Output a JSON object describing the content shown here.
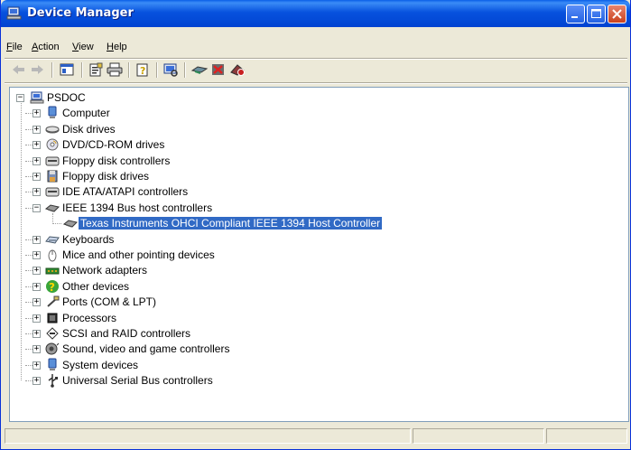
{
  "window": {
    "title": "Device Manager"
  },
  "menu": [
    {
      "label": "File",
      "accel": "F",
      "rest": "ile"
    },
    {
      "label": "Action",
      "accel": "A",
      "rest": "ction"
    },
    {
      "label": "View",
      "accel": "V",
      "rest": "iew"
    },
    {
      "label": "Help",
      "accel": "H",
      "rest": "elp"
    }
  ],
  "toolbar": [
    "back-arrow-icon",
    "forward-arrow-icon",
    "console-tree-icon",
    "properties-icon",
    "print-icon",
    "help-icon",
    "scan-hardware-icon",
    "update-driver-icon",
    "uninstall-icon",
    "disable-icon"
  ],
  "tree": {
    "root": {
      "label": "PSDOC",
      "icon": "computer-icon"
    },
    "items": [
      {
        "label": "Computer",
        "icon": "computer-icon"
      },
      {
        "label": "Disk drives",
        "icon": "disk-drive-icon"
      },
      {
        "label": "DVD/CD-ROM drives",
        "icon": "cd-drive-icon"
      },
      {
        "label": "Floppy disk controllers",
        "icon": "controller-icon"
      },
      {
        "label": "Floppy disk drives",
        "icon": "floppy-icon"
      },
      {
        "label": "IDE ATA/ATAPI controllers",
        "icon": "controller-icon"
      },
      {
        "label": "IEEE 1394 Bus host controllers",
        "icon": "ieee1394-icon",
        "expanded": true
      },
      {
        "label": "Texas Instruments OHCI Compliant IEEE 1394 Host Controller",
        "icon": "ieee1394-icon",
        "child": true,
        "selected": true
      },
      {
        "label": "Keyboards",
        "icon": "keyboard-icon"
      },
      {
        "label": "Mice and other pointing devices",
        "icon": "mouse-icon"
      },
      {
        "label": "Network adapters",
        "icon": "network-icon"
      },
      {
        "label": "Other devices",
        "icon": "unknown-device-icon"
      },
      {
        "label": "Ports (COM & LPT)",
        "icon": "port-icon"
      },
      {
        "label": "Processors",
        "icon": "processor-icon"
      },
      {
        "label": "SCSI and RAID controllers",
        "icon": "scsi-icon"
      },
      {
        "label": "Sound, video and game controllers",
        "icon": "sound-icon"
      },
      {
        "label": "System devices",
        "icon": "system-icon"
      },
      {
        "label": "Universal Serial Bus controllers",
        "icon": "usb-icon"
      }
    ]
  },
  "colors": {
    "titlebar": "#0054e3",
    "selection": "#316ac5",
    "window_bg": "#ece9d8"
  }
}
